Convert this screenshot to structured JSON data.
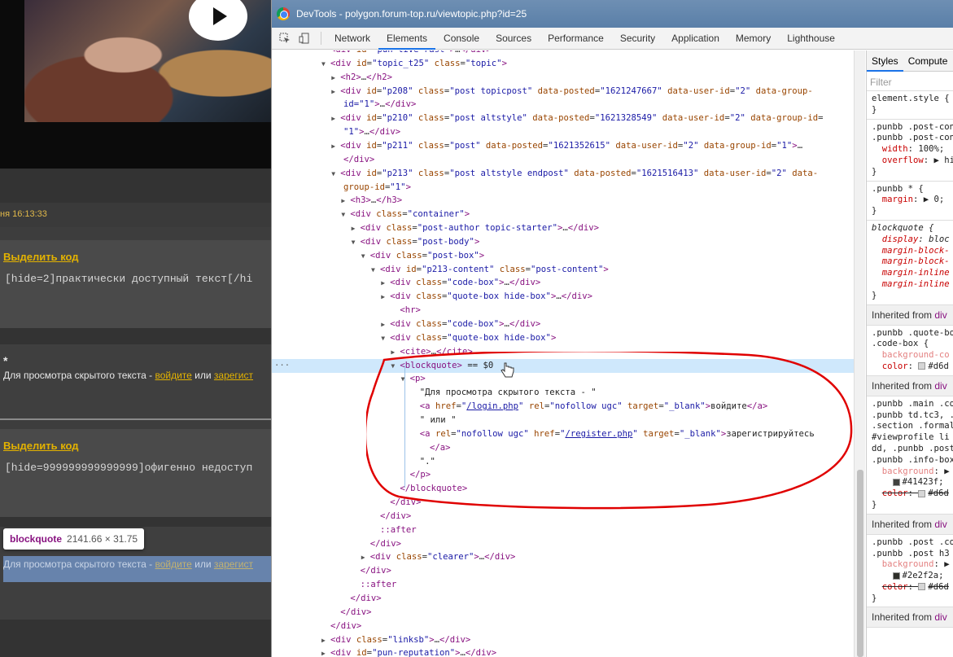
{
  "page": {
    "timestamp": "ня 16:13:33",
    "select_code": "Выделить код",
    "code1": "[hide=2]практически доступный текст[/hi",
    "star": "*",
    "hidden_prefix": "Для просмотра скрытого текста - ",
    "login_link": "войдите",
    "or": " или ",
    "register_link": "зарегист",
    "code2": "[hide=999999999999999]офигенно недоступ",
    "tooltip_tag": "blockquote",
    "tooltip_dims": "2141.66 × 31.75"
  },
  "devtools": {
    "title": "DevTools - polygon.forum-top.ru/viewtopic.php?id=25",
    "tabs": [
      "Network",
      "Elements",
      "Console",
      "Sources",
      "Performance",
      "Security",
      "Application",
      "Memory",
      "Lighthouse"
    ],
    "active_tab": "Elements"
  },
  "dom_lines": [
    {
      "i": 5,
      "a": "",
      "h": "<span class='tg'>&lt;div</span> <span class='at'>id</span>=<span class='av'>\"pun-live-rast\"</span><span class='tg'>&gt;</span>…<span class='tg'>&lt;/div&gt;</span>"
    },
    {
      "i": 5,
      "a": "▼",
      "h": "<span class='tg'>&lt;div</span> <span class='at'>id</span>=<span class='av'>\"topic_t25\"</span> <span class='at'>class</span>=<span class='av'>\"topic\"</span><span class='tg'>&gt;</span>"
    },
    {
      "i": 6,
      "a": "▶",
      "h": "<span class='tg'>&lt;h2&gt;</span>…<span class='tg'>&lt;/h2&gt;</span>"
    },
    {
      "i": 6,
      "a": "▶",
      "h": "<span class='tg'>&lt;div</span> <span class='at'>id</span>=<span class='av'>\"p208\"</span> <span class='at'>class</span>=<span class='av'>\"post topicpost\"</span> <span class='at'>data-posted</span>=<span class='av'>\"1621247667\"</span> <span class='at'>data-user-id</span>=<span class='av'>\"2\"</span> <span class='at'>data-group-</span>"
    },
    {
      "i": 0,
      "a": "",
      "h": "<span class='av'>id=\"1\"</span><span class='tg'>&gt;</span>…<span class='tg'>&lt;/div&gt;</span>",
      "x": 88
    },
    {
      "i": 6,
      "a": "▶",
      "h": "<span class='tg'>&lt;div</span> <span class='at'>id</span>=<span class='av'>\"p210\"</span> <span class='at'>class</span>=<span class='av'>\"post altstyle\"</span> <span class='at'>data-posted</span>=<span class='av'>\"1621328549\"</span> <span class='at'>data-user-id</span>=<span class='av'>\"2\"</span> <span class='at'>data-group-id</span>="
    },
    {
      "i": 0,
      "a": "",
      "h": "<span class='av'>\"1\"</span><span class='tg'>&gt;</span>…<span class='tg'>&lt;/div&gt;</span>",
      "x": 88
    },
    {
      "i": 6,
      "a": "▶",
      "h": "<span class='tg'>&lt;div</span> <span class='at'>id</span>=<span class='av'>\"p211\"</span> <span class='at'>class</span>=<span class='av'>\"post\"</span> <span class='at'>data-posted</span>=<span class='av'>\"1621352615\"</span> <span class='at'>data-user-id</span>=<span class='av'>\"2\"</span> <span class='at'>data-group-id</span>=<span class='av'>\"1\"</span><span class='tg'>&gt;</span>…"
    },
    {
      "i": 0,
      "a": "",
      "h": "<span class='tg'>&lt;/div&gt;</span>",
      "x": 88
    },
    {
      "i": 6,
      "a": "▼",
      "h": "<span class='tg'>&lt;div</span> <span class='at'>id</span>=<span class='av'>\"p213\"</span> <span class='at'>class</span>=<span class='av'>\"post altstyle endpost\"</span> <span class='at'>data-posted</span>=<span class='av'>\"1621516413\"</span> <span class='at'>data-user-id</span>=<span class='av'>\"2\"</span> <span class='at'>data-</span>"
    },
    {
      "i": 0,
      "a": "",
      "h": "<span class='at'>group-id</span>=<span class='av'>\"1\"</span><span class='tg'>&gt;</span>",
      "x": 88
    },
    {
      "i": 7,
      "a": "▶",
      "h": "<span class='tg'>&lt;h3&gt;</span>…<span class='tg'>&lt;/h3&gt;</span>"
    },
    {
      "i": 7,
      "a": "▼",
      "h": "<span class='tg'>&lt;div</span> <span class='at'>class</span>=<span class='av'>\"container\"</span><span class='tg'>&gt;</span>"
    },
    {
      "i": 8,
      "a": "▶",
      "h": "<span class='tg'>&lt;div</span> <span class='at'>class</span>=<span class='av'>\"post-author topic-starter\"</span><span class='tg'>&gt;</span>…<span class='tg'>&lt;/div&gt;</span>"
    },
    {
      "i": 8,
      "a": "▼",
      "h": "<span class='tg'>&lt;div</span> <span class='at'>class</span>=<span class='av'>\"post-body\"</span><span class='tg'>&gt;</span>"
    },
    {
      "i": 9,
      "a": "▼",
      "h": "<span class='tg'>&lt;div</span> <span class='at'>class</span>=<span class='av'>\"post-box\"</span><span class='tg'>&gt;</span>"
    },
    {
      "i": 10,
      "a": "▼",
      "h": "<span class='tg'>&lt;div</span> <span class='at'>id</span>=<span class='av'>\"p213-content\"</span> <span class='at'>class</span>=<span class='av'>\"post-content\"</span><span class='tg'>&gt;</span>"
    },
    {
      "i": 11,
      "a": "▶",
      "h": "<span class='tg'>&lt;div</span> <span class='at'>class</span>=<span class='av'>\"code-box\"</span><span class='tg'>&gt;</span>…<span class='tg'>&lt;/div&gt;</span>"
    },
    {
      "i": 11,
      "a": "▶",
      "h": "<span class='tg'>&lt;div</span> <span class='at'>class</span>=<span class='av'>\"quote-box hide-box\"</span><span class='tg'>&gt;</span>…<span class='tg'>&lt;/div&gt;</span>"
    },
    {
      "i": 12,
      "a": "",
      "h": "<span class='tg'>&lt;hr&gt;</span>"
    },
    {
      "i": 11,
      "a": "▶",
      "h": "<span class='tg'>&lt;div</span> <span class='at'>class</span>=<span class='av'>\"code-box\"</span><span class='tg'>&gt;</span>…<span class='tg'>&lt;/div&gt;</span>"
    },
    {
      "i": 11,
      "a": "▼",
      "h": "<span class='tg'>&lt;div</span> <span class='at'>class</span>=<span class='av'>\"quote-box hide-box\"</span><span class='tg'>&gt;</span>"
    },
    {
      "i": 12,
      "a": "▶",
      "h": "<span class='tg'>&lt;cite&gt;</span>…<span class='tg'>&lt;/cite&gt;</span>"
    },
    {
      "i": 12,
      "a": "▼",
      "h": "<span class='tg'>&lt;blockquote&gt;</span> <span class='tx'>== $0</span>",
      "sel": true
    },
    {
      "i": 13,
      "a": "▼",
      "h": "<span class='tg'>&lt;p&gt;</span>"
    },
    {
      "i": 14,
      "a": "",
      "h": "<span class='tx'>\"Для просмотра скрытого текста - \"</span>"
    },
    {
      "i": 14,
      "a": "",
      "h": "<span class='tg'>&lt;a</span> <span class='at'>href</span>=<span class='av'>\"<span class='lnk'>/login.php</span>\"</span> <span class='at'>rel</span>=<span class='av'>\"nofollow ugc\"</span> <span class='at'>target</span>=<span class='av'>\"_blank\"</span><span class='tg'>&gt;</span><span class='tx'>войдите</span><span class='tg'>&lt;/a&gt;</span>"
    },
    {
      "i": 14,
      "a": "",
      "h": "<span class='tx'>\" или \"</span>"
    },
    {
      "i": 14,
      "a": "",
      "h": "<span class='tg'>&lt;a</span> <span class='at'>rel</span>=<span class='av'>\"nofollow ugc\"</span> <span class='at'>href</span>=<span class='av'>\"<span class='lnk'>/register.php</span>\"</span> <span class='at'>target</span>=<span class='av'>\"_blank\"</span><span class='tg'>&gt;</span><span class='tx'>зарегистрируйтесь</span>"
    },
    {
      "i": 15,
      "a": "",
      "h": "<span class='tg'>&lt;/a&gt;</span>"
    },
    {
      "i": 14,
      "a": "",
      "h": "<span class='tx'>\".\"</span>"
    },
    {
      "i": 13,
      "a": "",
      "h": "<span class='tg'>&lt;/p&gt;</span>"
    },
    {
      "i": 12,
      "a": "",
      "h": "<span class='tg'>&lt;/blockquote&gt;</span>"
    },
    {
      "i": 11,
      "a": "",
      "h": "<span class='tg'>&lt;/div&gt;</span>"
    },
    {
      "i": 10,
      "a": "",
      "h": "<span class='tg'>&lt;/div&gt;</span>"
    },
    {
      "i": 10,
      "a": "",
      "h": "<span class='pseudo'>::after</span>"
    },
    {
      "i": 9,
      "a": "",
      "h": "<span class='tg'>&lt;/div&gt;</span>"
    },
    {
      "i": 9,
      "a": "▶",
      "h": "<span class='tg'>&lt;div</span> <span class='at'>class</span>=<span class='av'>\"clearer\"</span><span class='tg'>&gt;</span>…<span class='tg'>&lt;/div&gt;</span>"
    },
    {
      "i": 8,
      "a": "",
      "h": "<span class='tg'>&lt;/div&gt;</span>"
    },
    {
      "i": 8,
      "a": "",
      "h": "<span class='pseudo'>::after</span>"
    },
    {
      "i": 7,
      "a": "",
      "h": "<span class='tg'>&lt;/div&gt;</span>"
    },
    {
      "i": 6,
      "a": "",
      "h": "<span class='tg'>&lt;/div&gt;</span>"
    },
    {
      "i": 5,
      "a": "",
      "h": "<span class='tg'>&lt;/div&gt;</span>"
    },
    {
      "i": 5,
      "a": "▶",
      "h": "<span class='tg'>&lt;div</span> <span class='at'>class</span>=<span class='av'>\"linksb\"</span><span class='tg'>&gt;</span>…<span class='tg'>&lt;/div&gt;</span>"
    },
    {
      "i": 5,
      "a": "▶",
      "h": "<span class='tg'>&lt;div</span> <span class='at'>id</span>=<span class='av'>\"pun-reputation\"</span><span class='tg'>&gt;</span>…<span class='tg'>&lt;/div&gt;</span>"
    }
  ],
  "styles": {
    "tabs": [
      "Styles",
      "Compute"
    ],
    "filter_placeholder": "Filter"
  }
}
